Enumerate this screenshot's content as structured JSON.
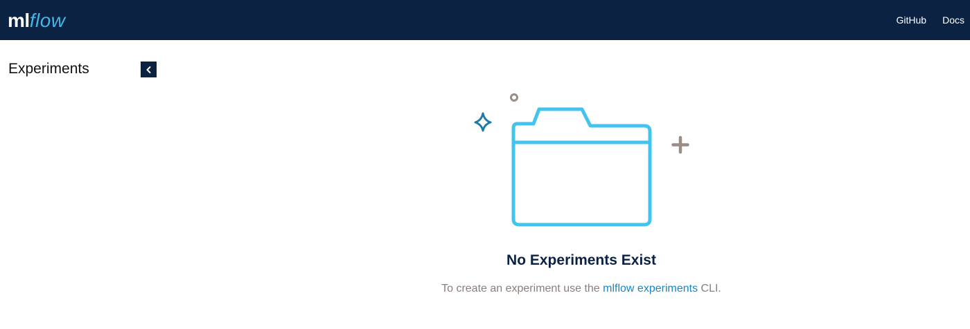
{
  "header": {
    "logo_ml": "ml",
    "logo_flow": "flow",
    "nav": [
      {
        "label": "GitHub"
      },
      {
        "label": "Docs"
      }
    ]
  },
  "sidebar": {
    "title": "Experiments",
    "collapse_icon": "chevron-left-icon"
  },
  "empty_state": {
    "illustration_icon": "folder-icon",
    "title": "No Experiments Exist",
    "desc_prefix": "To create an experiment use the ",
    "desc_link": "mlflow experiments",
    "desc_suffix": " CLI."
  },
  "colors": {
    "header_bg": "#0b2243",
    "accent": "#43b6e3",
    "link": "#1787c4",
    "muted": "#8a7e7a"
  }
}
